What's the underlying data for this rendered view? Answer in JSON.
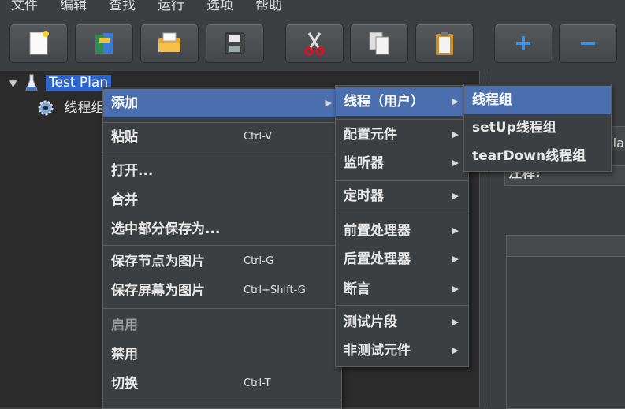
{
  "menubar": {
    "items": [
      "文件",
      "编辑",
      "查找",
      "运行",
      "选项",
      "帮助"
    ]
  },
  "toolbar": {
    "buttons": [
      {
        "icon": "new-document-icon"
      },
      {
        "icon": "templates-icon"
      },
      {
        "icon": "open-folder-icon"
      },
      {
        "icon": "save-icon"
      },
      {
        "icon": "cut-icon"
      },
      {
        "icon": "copy-icon"
      },
      {
        "icon": "paste-icon"
      },
      {
        "icon": "expand-plus-icon"
      },
      {
        "icon": "collapse-minus-icon"
      }
    ]
  },
  "tree": {
    "root_label": "Test Plan",
    "child_label": "线程组"
  },
  "right_pane": {
    "comment_label": "注释:",
    "edge_text": "Pla"
  },
  "context_menu": {
    "add": "添加",
    "paste": "粘贴",
    "paste_shortcut": "Ctrl-V",
    "open": "打开...",
    "merge": "合并",
    "save_selection": "选中部分保存为...",
    "save_node_image": "保存节点为图片",
    "save_node_image_shortcut": "Ctrl-G",
    "save_screen_image": "保存屏幕为图片",
    "save_screen_image_shortcut": "Ctrl+Shift-G",
    "enable": "启用",
    "disable": "禁用",
    "toggle": "切换",
    "toggle_shortcut": "Ctrl-T"
  },
  "add_submenu": {
    "threads": "线程（用户）",
    "config": "配置元件",
    "listener": "监听器",
    "timer": "定时器",
    "pre": "前置处理器",
    "post": "后置处理器",
    "assertion": "断言",
    "fragment": "测试片段",
    "non_test": "非测试元件"
  },
  "threads_submenu": {
    "thread_group": "线程组",
    "setup": "setUp线程组",
    "teardown": "tearDown线程组"
  },
  "colors": {
    "selection": "#2f65ca",
    "menu_highlight": "#4b6eaf",
    "background": "#3c3f41"
  }
}
